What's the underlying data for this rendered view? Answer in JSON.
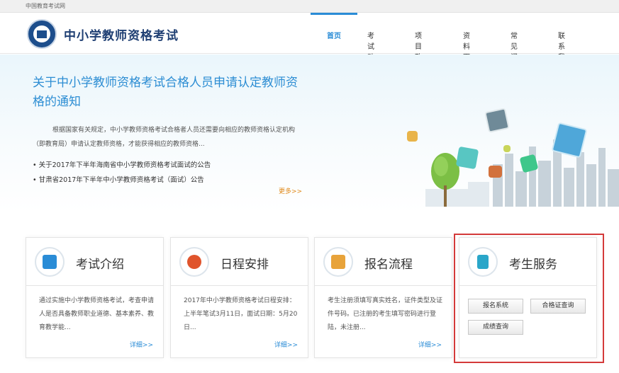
{
  "topbar": {
    "site_name": "中国教育考试网"
  },
  "header": {
    "logo_text": "中小学教师资格考试",
    "nav": [
      {
        "label": "首页"
      },
      {
        "label": "考试动态"
      },
      {
        "label": "项目政策"
      },
      {
        "label": "资料下载"
      },
      {
        "label": "常见问题"
      },
      {
        "label": "联系我们"
      }
    ]
  },
  "hero": {
    "title": "关于中小学教师资格考试合格人员申请认定教师资格的通知",
    "description": "根据国家有关规定，中小学教师资格考试合格者人员还需要向相应的教师资格认定机构（即教育局）申请认定教师资格，才能获得相应的教师资格...",
    "items": [
      {
        "text": "关于2017年下半年海南省中小学教师资格考试面试的公告"
      },
      {
        "text": "甘肃省2017年下半年中小学教师资格考试（面试）公告"
      }
    ],
    "more": "更多>>"
  },
  "cards": [
    {
      "title": "考试介绍",
      "icon": "exam-intro-icon",
      "text": "通过实施中小学教师资格考试，考查申请人是否具备教师职业道德、基本素养、教育教学能...",
      "more": "详细>>",
      "color": "#2a8cd6"
    },
    {
      "title": "日程安排",
      "icon": "schedule-check-icon",
      "text": "2017年中小学教师资格考试日程安排：上半年笔试3月11日，面试日期：5月20日...",
      "more": "详细>>",
      "color": "#e0542c"
    },
    {
      "title": "报名流程",
      "icon": "registration-process-icon",
      "text": "考生注册须填写真实姓名，证件类型及证件号码。已注册的考生填写密码进行登陆，未注册...",
      "more": "详细>>",
      "color": "#e8a33a"
    }
  ],
  "service": {
    "title": "考生服务",
    "icon": "candidate-service-icon",
    "buttons": [
      {
        "label": "报名系统"
      },
      {
        "label": "合格证查询"
      },
      {
        "label": "成绩查询"
      }
    ],
    "highlight_color": "#d43a3a"
  }
}
